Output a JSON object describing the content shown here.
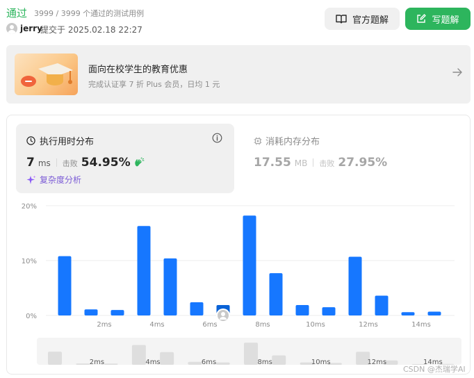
{
  "header": {
    "status": "通过",
    "testcases": "3999 / 3999 个通过的测试用例",
    "user": "jerry",
    "submitted": "提交于 2025.02.18 22:27",
    "official_solution": "官方题解",
    "write_solution": "写题解"
  },
  "promo": {
    "title": "面向在校学生的教育优惠",
    "subtitle": "完成认证享 7 折 Plus 会员，日均 1 元"
  },
  "runtime": {
    "title": "执行用时分布",
    "value": "7",
    "unit": "ms",
    "beat_label": "击败",
    "beat_value": "54.95%",
    "complexity": "复杂度分析"
  },
  "memory": {
    "title": "消耗内存分布",
    "value": "17.55",
    "unit": "MB",
    "beat_label": "击败",
    "beat_value": "27.95%"
  },
  "watermark": "CSDN @杰瑞学AI",
  "colors": {
    "accent_green": "#2db55d",
    "bar_blue": "#1677ff",
    "bar_highlight": "#0a62d6",
    "overview_bar": "#dedede"
  },
  "chart_data": {
    "type": "bar",
    "y_tick_labels": [
      "20%",
      "10%",
      "0%"
    ],
    "ylim": [
      0,
      20
    ],
    "x_tick_labels": [
      "2ms",
      "4ms",
      "6ms",
      "8ms",
      "10ms",
      "12ms",
      "14ms"
    ],
    "x_ticks": [
      2,
      4,
      6,
      8,
      10,
      12,
      14
    ],
    "xlim": [
      0.5,
      15
    ],
    "x": [
      1,
      2,
      3,
      4,
      5,
      6,
      7,
      8,
      9,
      10,
      11,
      12,
      13,
      14,
      15
    ],
    "values": [
      10.8,
      1.1,
      1.0,
      16.3,
      10.4,
      2.4,
      1.9,
      18.2,
      7.7,
      1.9,
      1.5,
      10.7,
      3.6,
      0.6,
      0.7
    ],
    "highlight_x": 7,
    "overview_tick_labels": [
      "2ms",
      "4ms",
      "6ms",
      "8ms",
      "10ms",
      "12ms",
      "14ms"
    ]
  }
}
